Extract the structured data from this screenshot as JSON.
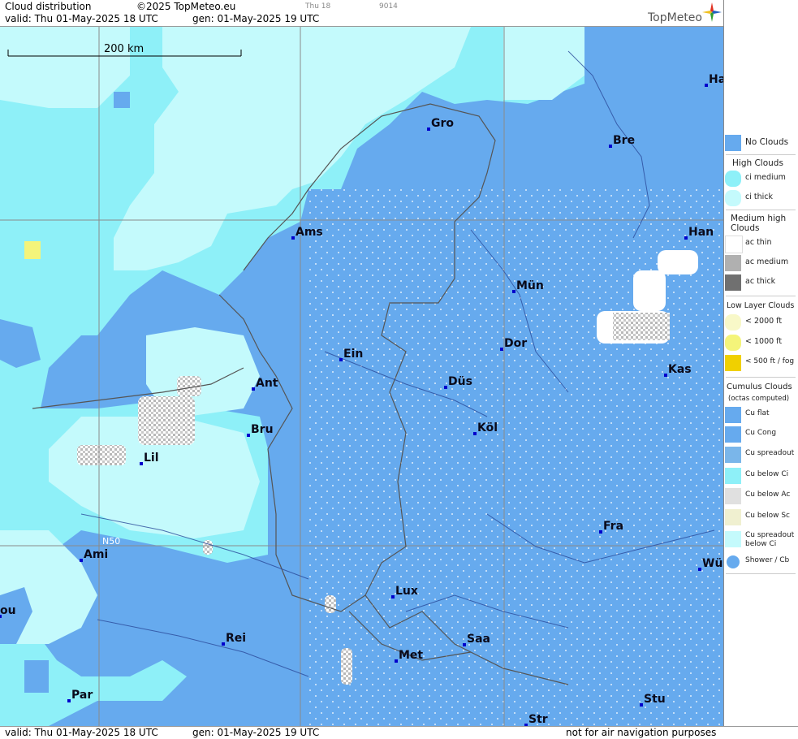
{
  "header": {
    "title": "Cloud distribution",
    "copyright": "©2025 TopMeteo.eu",
    "tab_time": "Thu 18",
    "tab_code": "9014",
    "valid": "valid:  Thu  01-May-2025  18 UTC",
    "gen": "gen: 01-May-2025 19 UTC",
    "logo": "TopMeteo"
  },
  "footer": {
    "valid": "valid:  Thu  01-May-2025  18 UTC",
    "gen": "gen: 01-May-2025 19 UTC",
    "note": "not for air navigation purposes"
  },
  "map": {
    "scale_label": "200 km",
    "lat_label": "N50",
    "cities": [
      "Ha",
      "Gro",
      "Bre",
      "Ams",
      "Han",
      "Mün",
      "Dor",
      "Ein",
      "Kas",
      "Ant",
      "Düs",
      "Bru",
      "Köl",
      "Lil",
      "Fra",
      "Ami",
      "Wü",
      "Lux",
      "ou",
      "Rei",
      "Saa",
      "Met",
      "Par",
      "Stu",
      "Str"
    ]
  },
  "legend": {
    "no_clouds": "No Clouds",
    "high_head": "High Clouds",
    "ci_medium": "ci medium",
    "ci_thick": "ci thick",
    "mid_head1": "Medium high",
    "mid_head2": "Clouds",
    "ac_thin": "ac thin",
    "ac_medium": "ac medium",
    "ac_thick": "ac thick",
    "low_head": "Low Layer Clouds",
    "low_2000": "< 2000 ft",
    "low_1000": "< 1000 ft",
    "low_500": "< 500 ft / fog",
    "cu_head": "Cumulus Clouds",
    "cu_sub": "(octas computed)",
    "cu_flat": "Cu flat",
    "cu_cong": "Cu Cong",
    "cu_spreadout": "Cu spreadout",
    "cu_below_ci": "Cu below Ci",
    "cu_below_ac": "Cu below Ac",
    "cu_below_sc": "Cu below Sc",
    "cu_spread_ci1": "Cu spreadout",
    "cu_spread_ci2": "below Ci",
    "shower": "Shower / Cb"
  },
  "colors": {
    "no_clouds": "#66aaee",
    "ci_medium": "#8ef0f8",
    "ci_thick": "#c4fafc",
    "low_1000": "#f4f47a"
  }
}
